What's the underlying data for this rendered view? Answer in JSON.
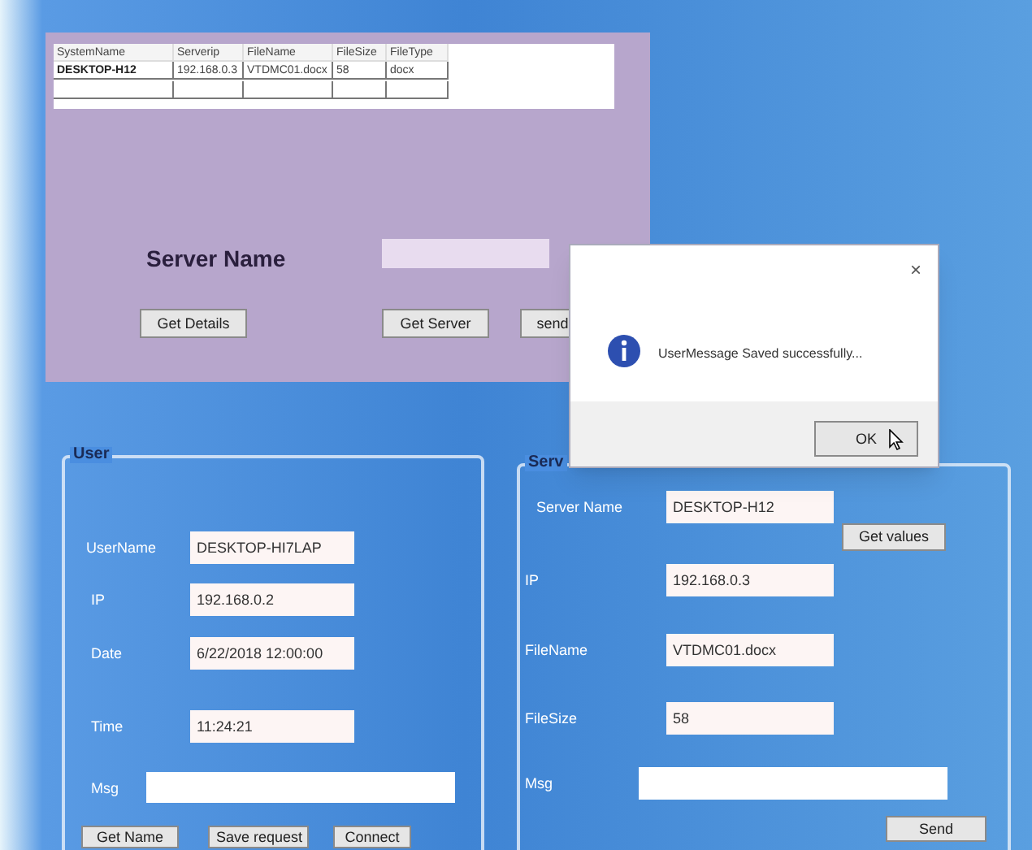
{
  "main_panel": {
    "grid": {
      "columns": [
        "SystemName",
        "Serverip",
        "FileName",
        "FileSize",
        "FileType"
      ],
      "rows": [
        [
          "DESKTOP-H12",
          "192.168.0.3",
          "VTDMC01.docx",
          "58",
          "docx"
        ]
      ]
    },
    "server_name_label": "Server Name",
    "buttons": [
      "Get Details",
      "Get Server",
      "send"
    ]
  },
  "dialog": {
    "message": "UserMessage Saved successfully...",
    "close": "×",
    "button": "OK"
  },
  "user_group": {
    "title": "User",
    "fields": [
      {
        "label": "UserName",
        "value": "DESKTOP-HI7LAP"
      },
      {
        "label": "IP",
        "value": "192.168.0.2"
      },
      {
        "label": "Date",
        "value": "6/22/2018 12:00:00"
      },
      {
        "label": "Time",
        "value": "11:24:21"
      },
      {
        "label": "Msg"
      }
    ],
    "buttons": [
      "Get Name",
      "Save request",
      "Connect"
    ]
  },
  "server_group": {
    "title": "Serv",
    "fields": [
      {
        "label": "Server Name",
        "value": "DESKTOP-H12"
      },
      {
        "label": "IP",
        "value": "192.168.0.3"
      },
      {
        "label": "FileName",
        "value": "VTDMC01.docx"
      },
      {
        "label": "FileSize",
        "value": "58"
      },
      {
        "label": "Msg"
      }
    ],
    "buttons": [
      "Get values",
      "Send"
    ]
  }
}
